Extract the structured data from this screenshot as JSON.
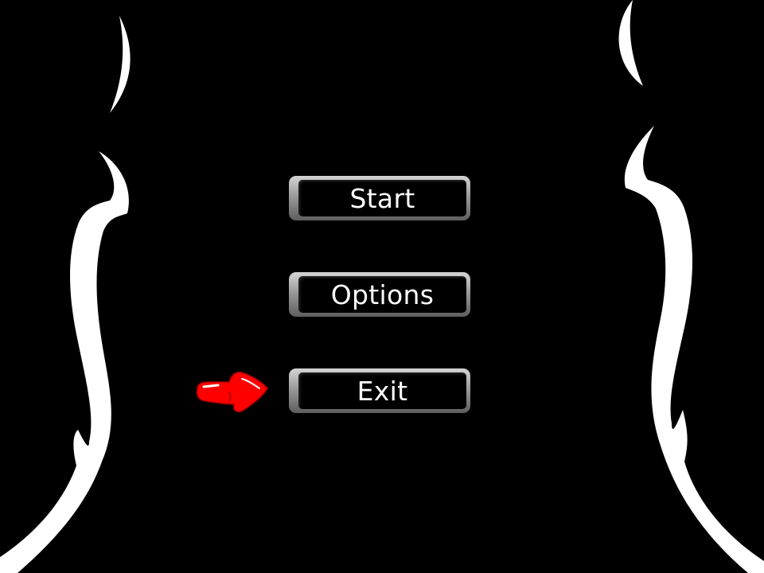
{
  "menu": {
    "items": [
      {
        "id": "start",
        "label": "Start"
      },
      {
        "id": "options",
        "label": "Options"
      },
      {
        "id": "exit",
        "label": "Exit"
      }
    ],
    "selected": "exit"
  },
  "cursor": {
    "icon": "red-pointing-hand-icon",
    "color": "#ff0000"
  },
  "decoration": {
    "icon": "white-swirl-border-icon",
    "color": "#ffffff"
  },
  "colors": {
    "background": "#000000",
    "button_frame": "#9a9a9a",
    "button_text": "#ffffff"
  }
}
